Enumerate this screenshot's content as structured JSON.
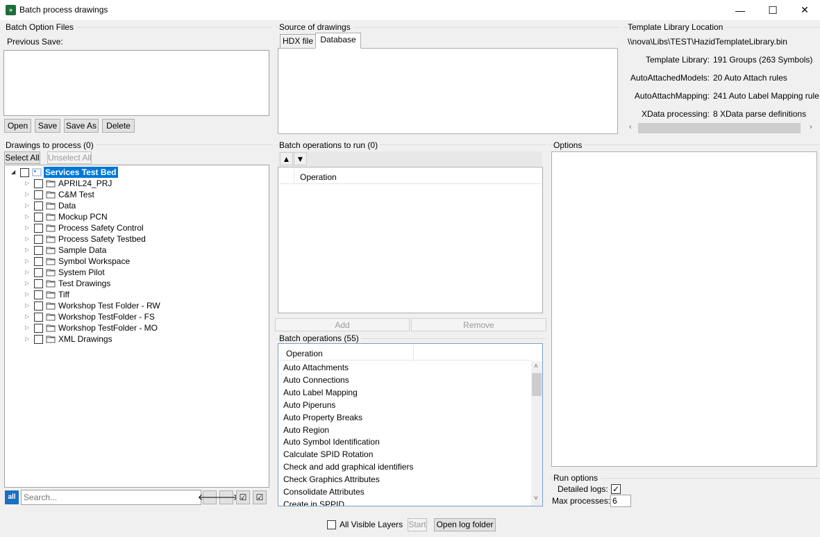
{
  "window": {
    "title": "Batch process drawings",
    "minimize_glyph": "—",
    "maximize_glyph": "☐",
    "close_glyph": "✕"
  },
  "batch_option_files": {
    "group_label": "Batch Option Files",
    "previous_save_label": "Previous Save:",
    "buttons": {
      "open": "Open",
      "save": "Save",
      "save_as": "Save As",
      "delete": "Delete"
    }
  },
  "source": {
    "group_label": "Source of drawings",
    "tabs": [
      {
        "label": "HDX file",
        "selected": false
      },
      {
        "label": "Database",
        "selected": true
      }
    ]
  },
  "template_library": {
    "group_label": "Template Library Location",
    "path": "\\\\nova\\Libs\\TEST\\HazidTemplateLibrary.bin",
    "rows": [
      {
        "label": "Template Library:",
        "value": "191 Groups (263 Symbols)"
      },
      {
        "label": "AutoAttachedModels:",
        "value": "20 Auto Attach rules"
      },
      {
        "label": "AutoAttachMapping:",
        "value": "241 Auto Label Mapping rule"
      },
      {
        "label": "XData processing:",
        "value": "8 XData parse definitions"
      }
    ]
  },
  "drawings": {
    "group_label": "Drawings to process (0)",
    "select_all": "Select All",
    "unselect_all": "Unselect All",
    "root": {
      "label": "Services Test Bed"
    },
    "items": [
      {
        "label": "APRIL24_PRJ"
      },
      {
        "label": "C&M Test"
      },
      {
        "label": "Data"
      },
      {
        "label": "Mockup PCN"
      },
      {
        "label": "Process Safety Control"
      },
      {
        "label": "Process Safety Testbed"
      },
      {
        "label": "Sample Data"
      },
      {
        "label": "Symbol Workspace"
      },
      {
        "label": "System Pilot"
      },
      {
        "label": "Test Drawings"
      },
      {
        "label": "Tiff"
      },
      {
        "label": "Workshop Test Folder - RW"
      },
      {
        "label": "Workshop TestFolder - FS"
      },
      {
        "label": "Workshop TestFolder - MO"
      },
      {
        "label": "XML Drawings"
      }
    ],
    "search_placeholder": "Search...",
    "all_badge": "all"
  },
  "batch_ops_to_run": {
    "group_label": "Batch operations to run (0)",
    "column": "Operation",
    "add": "Add",
    "remove": "Remove"
  },
  "batch_ops": {
    "group_label": "Batch operations (55)",
    "column": "Operation",
    "items": [
      "Auto Attachments",
      "Auto Connections",
      "Auto Label Mapping",
      "Auto Piperuns",
      "Auto Property Breaks",
      "Auto Region",
      "Auto Symbol Identification",
      "Calculate SPID Rotation",
      "Check and add graphical identifiers",
      "Check Graphics Attributes",
      "Consolidate Attributes",
      "Create in SPPID"
    ]
  },
  "options": {
    "group_label": "Options"
  },
  "run_options": {
    "group_label": "Run options",
    "detailed_logs_label": "Detailed logs:",
    "detailed_logs_checked": true,
    "max_processes_label": "Max processes:",
    "max_processes_value": "6"
  },
  "footer": {
    "all_visible_layers": "All Visible Layers",
    "start": "Start",
    "open_log_folder": "Open log folder"
  }
}
